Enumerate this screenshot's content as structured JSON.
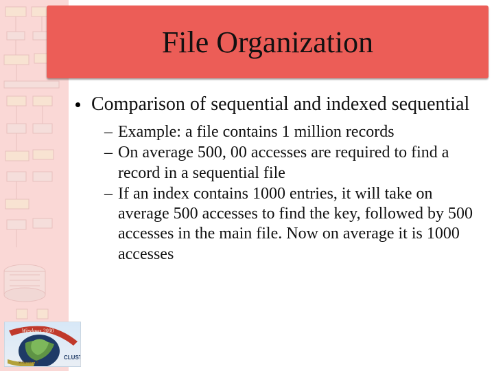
{
  "title": "File Organization",
  "bullet": "Comparison of sequential and indexed sequential",
  "sub_items": [
    "Example: a file contains 1 million records",
    "On average 500, 00 accesses are required to find a record in a sequential file",
    "If an index contains 1000 entries, it will take on average 500 accesses to find the key, followed by 500 accesses in the main file. Now on average it is 1000 accesses"
  ],
  "logo": {
    "top_label": "Windows 2000",
    "bottom_label": "solaris 2.x",
    "right_label": "CLUSTER"
  }
}
